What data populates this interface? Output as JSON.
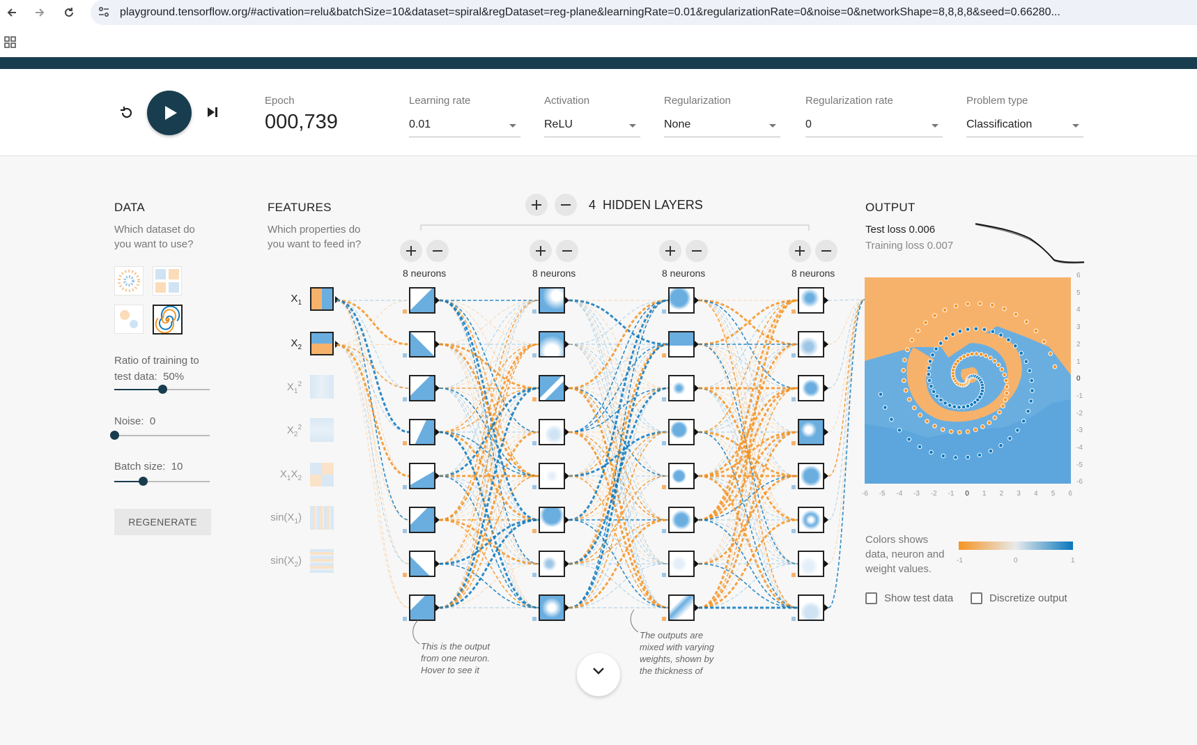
{
  "browser": {
    "url": "playground.tensorflow.org/#activation=relu&batchSize=10&dataset=spiral&regDataset=reg-plane&learningRate=0.01&regularizationRate=0&noise=0&networkShape=8,8,8,8&seed=0.66280..."
  },
  "controls": {
    "epoch_label": "Epoch",
    "epoch_value": "000,739",
    "learning_rate": {
      "label": "Learning rate",
      "value": "0.01"
    },
    "activation": {
      "label": "Activation",
      "value": "ReLU"
    },
    "regularization": {
      "label": "Regularization",
      "value": "None"
    },
    "regularization_rate": {
      "label": "Regularization rate",
      "value": "0"
    },
    "problem_type": {
      "label": "Problem type",
      "value": "Classification"
    }
  },
  "data": {
    "title": "DATA",
    "question": "Which dataset do you want to use?",
    "selected_dataset": "spiral",
    "ratio_label": "Ratio of training to test data:",
    "ratio_value": "50%",
    "ratio_fraction": 0.5,
    "noise_label": "Noise:",
    "noise_value": "0",
    "noise_fraction": 0.0,
    "batch_label": "Batch size:",
    "batch_value": "10",
    "batch_fraction": 0.3,
    "regenerate_label": "REGENERATE"
  },
  "features": {
    "title": "FEATURES",
    "question": "Which properties do you want to feed in?",
    "items": [
      {
        "base": "X",
        "sub": "1",
        "sup": "",
        "tail": "",
        "active": true
      },
      {
        "base": "X",
        "sub": "2",
        "sup": "",
        "tail": "",
        "active": true
      },
      {
        "base": "X",
        "sub": "1",
        "sup": "2",
        "tail": "",
        "active": false
      },
      {
        "base": "X",
        "sub": "2",
        "sup": "2",
        "tail": "",
        "active": false
      },
      {
        "base": "X",
        "sub": "1",
        "sup": "",
        "tail": "X",
        "tail_sub": "2",
        "active": false
      },
      {
        "base": "sin(X",
        "sub": "1",
        "sup": "",
        "tail": ")",
        "active": false
      },
      {
        "base": "sin(X",
        "sub": "2",
        "sup": "",
        "tail": ")",
        "active": false
      }
    ]
  },
  "network": {
    "hidden_layers_count": "4",
    "hidden_layers_label": "HIDDEN LAYERS",
    "layers": [
      {
        "neurons_label": "8 neurons"
      },
      {
        "neurons_label": "8 neurons"
      },
      {
        "neurons_label": "8 neurons"
      },
      {
        "neurons_label": "8 neurons"
      }
    ],
    "annotation_1": "This is the output from one neuron. Hover to see it",
    "annotation_2": "The outputs are mixed with varying weights, shown by the thickness of"
  },
  "output": {
    "title": "OUTPUT",
    "test_loss_label": "Test loss",
    "test_loss_value": "0.006",
    "training_loss_label": "Training loss",
    "training_loss_value": "0.007",
    "x_ticks": [
      "-6",
      "-5",
      "-4",
      "-3",
      "-2",
      "-1",
      "0",
      "1",
      "2",
      "3",
      "4",
      "5",
      "6"
    ],
    "y_ticks": [
      "6",
      "5",
      "4",
      "3",
      "2",
      "1",
      "0",
      "-1",
      "-2",
      "-3",
      "-4",
      "-5",
      "-6"
    ],
    "legend_text": "Colors shows data, neuron and weight values.",
    "legend_min": "-1",
    "legend_mid": "0",
    "legend_max": "1",
    "show_test_data_label": "Show test data",
    "discretize_output_label": "Discretize output"
  },
  "colors": {
    "orange": "#f59322",
    "blue": "#0877bd",
    "dark": "#183d4e"
  }
}
